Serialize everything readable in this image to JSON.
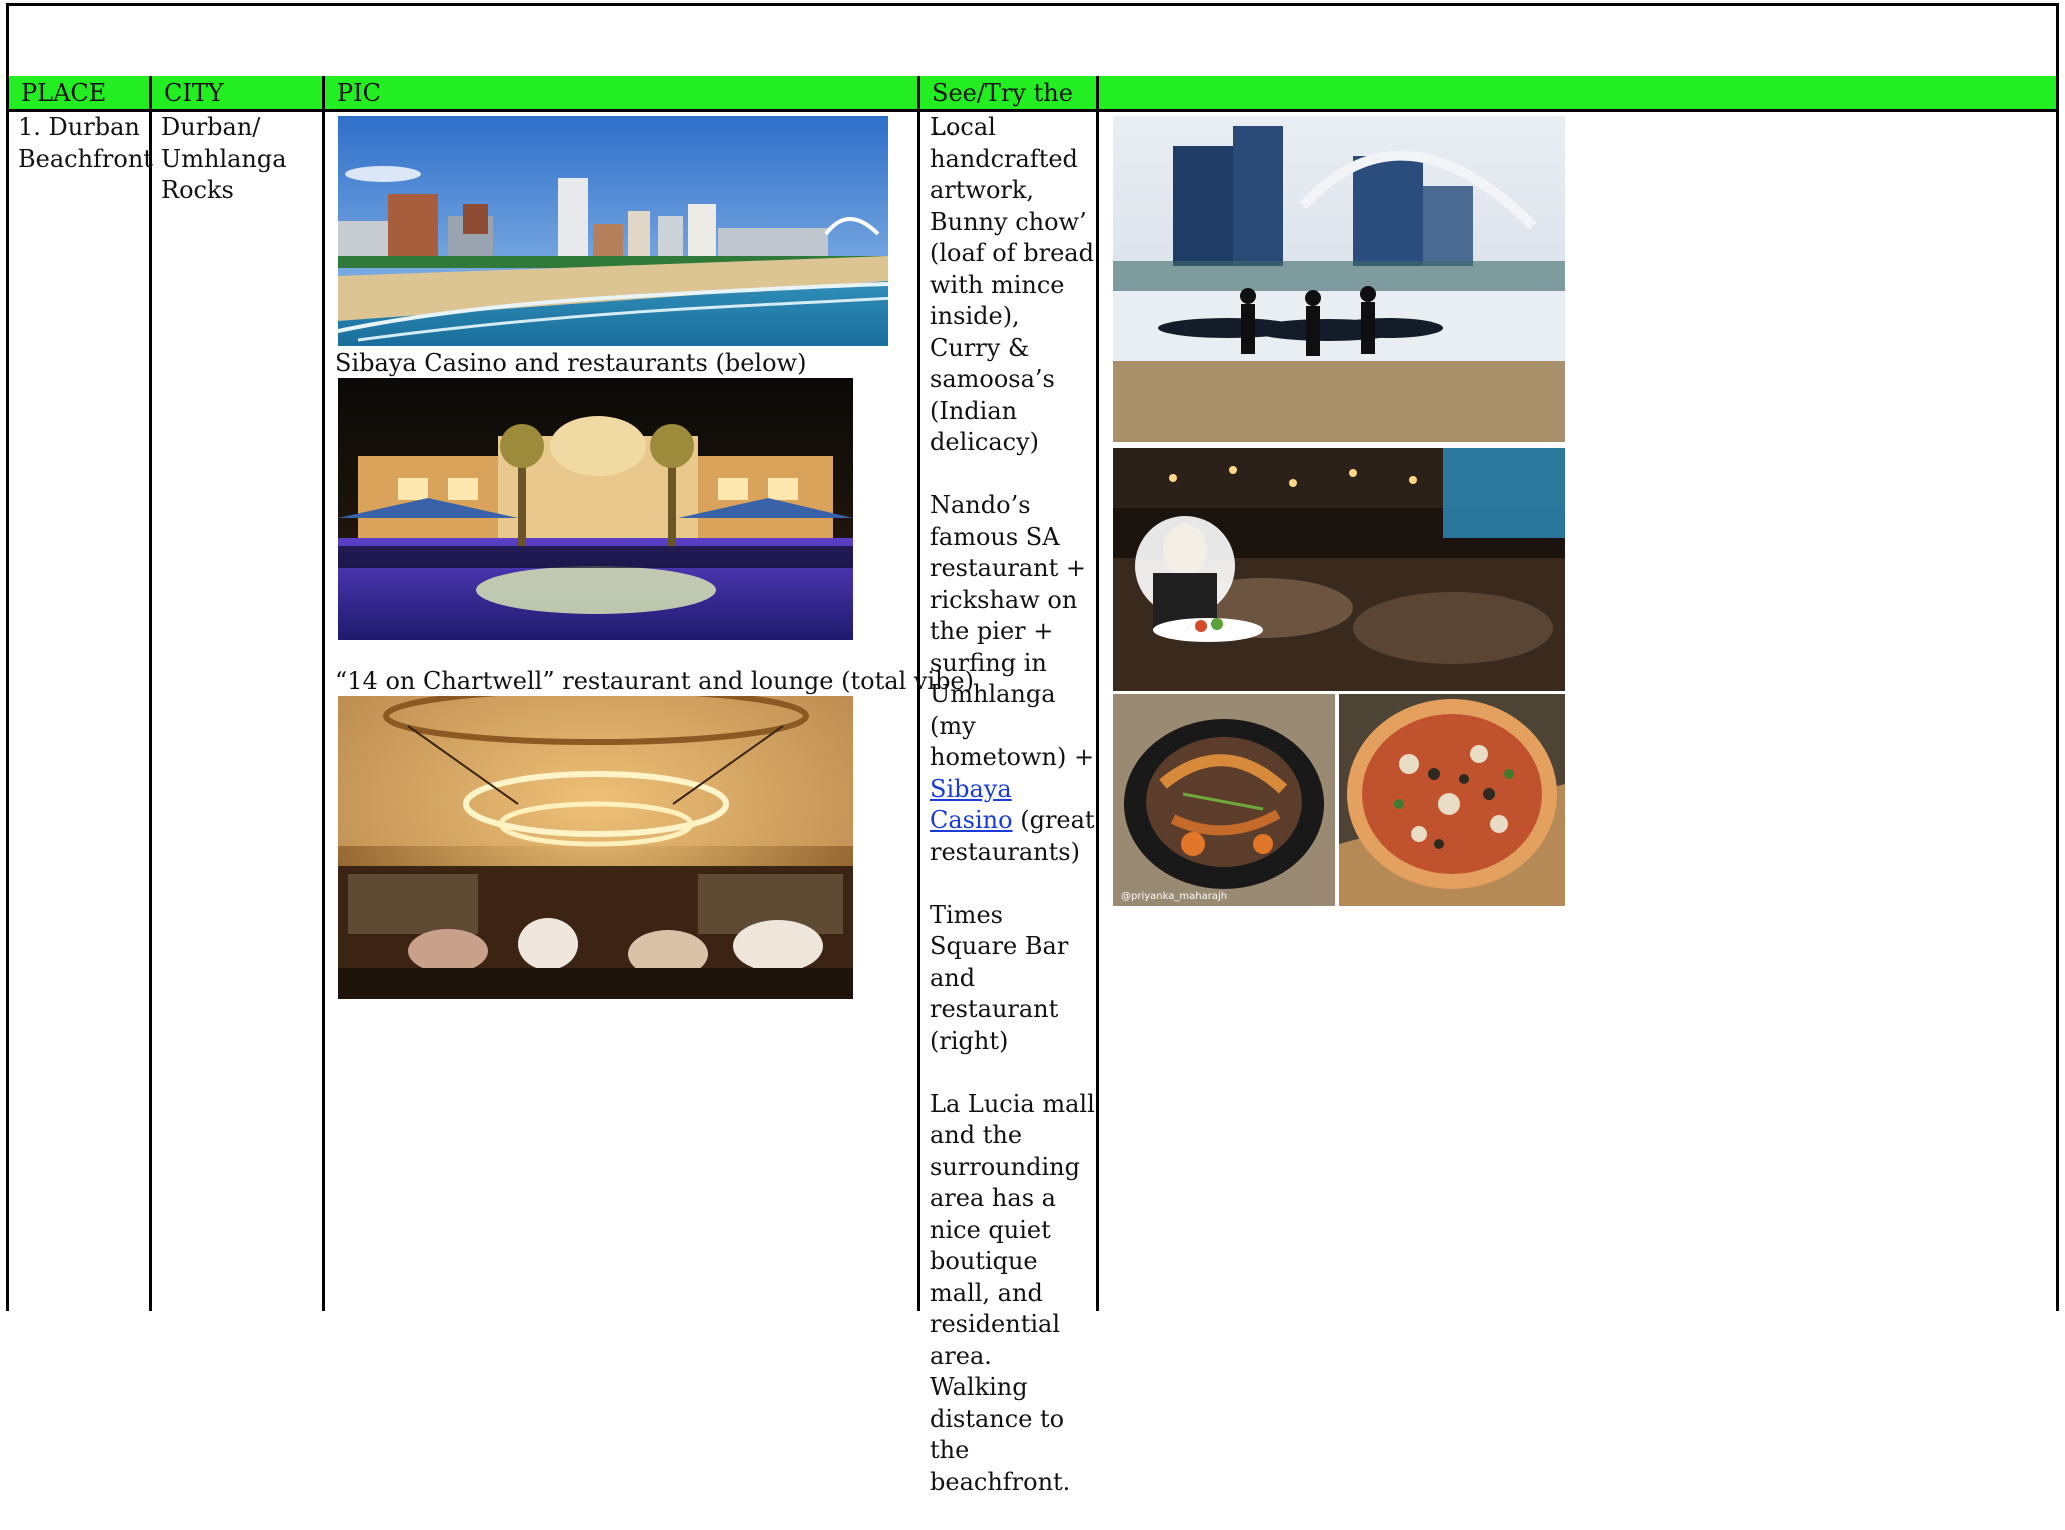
{
  "table": {
    "headers": {
      "place": "PLACE",
      "city": "CITY",
      "pic": "PIC",
      "see": "See/Try the …",
      "extra": ""
    },
    "row1": {
      "place": "1. Durban Beachfront",
      "city": "Durban/ Umhlanga Rocks",
      "captions": {
        "sibaya": "Sibaya Casino and restaurants (below)",
        "chartwell": "“14 on Chartwell” restaurant and lounge (total vibe)"
      },
      "see": {
        "p1": "Local handcrafted artwork, Bunny chow’ (loaf of bread with mince inside), Curry & samoosa’s (Indian delicacy)",
        "p2_before": "Nando’s famous SA restaurant + rickshaw on the pier + surfing in Umhlanga (my hometown) +",
        "p2_link": "Sibaya Casino",
        "p2_after": "(great restaurants)",
        "p3": "Times Square Bar and restaurant (right)",
        "p4": "La Lucia mall and the surrounding area has a nice quiet boutique mall, and residential area. Walking distance to the beachfront."
      },
      "photo_credit": "@priyanka_maharajh"
    }
  }
}
